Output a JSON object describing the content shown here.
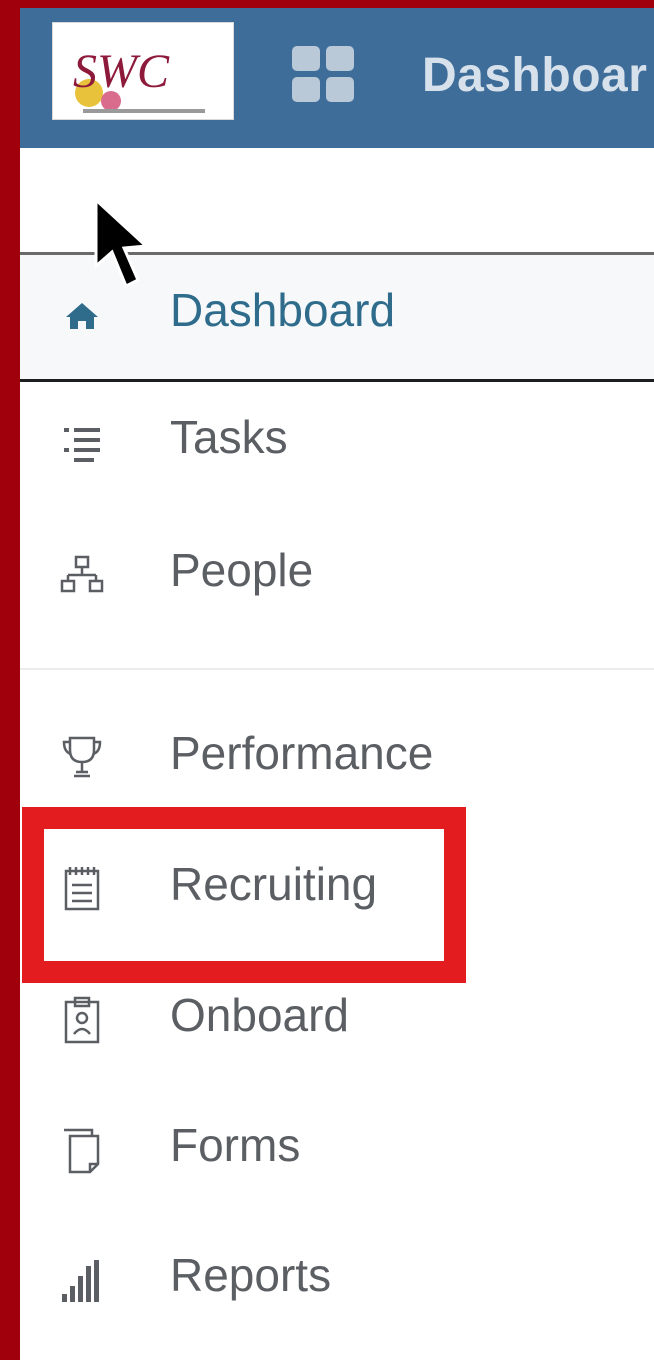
{
  "topbar": {
    "title": "Dashboar",
    "logo_text": "SWC",
    "background": "#3e6d99"
  },
  "nav": {
    "items": [
      {
        "label": "Dashboard",
        "icon": "home-icon",
        "active": true
      },
      {
        "label": "Tasks",
        "icon": "list-icon"
      },
      {
        "label": "People",
        "icon": "org-chart-icon"
      },
      {
        "label": "Performance",
        "icon": "trophy-icon"
      },
      {
        "label": "Recruiting",
        "icon": "notepad-icon",
        "highlighted": true
      },
      {
        "label": "Onboard",
        "icon": "clipboard-icon"
      },
      {
        "label": "Forms",
        "icon": "pages-icon"
      },
      {
        "label": "Reports",
        "icon": "bar-chart-icon"
      }
    ]
  },
  "colors": {
    "frame": "#a0000b",
    "highlight": "#e21c1f",
    "active_text": "#2f6c8c",
    "text": "#5b5f63"
  }
}
